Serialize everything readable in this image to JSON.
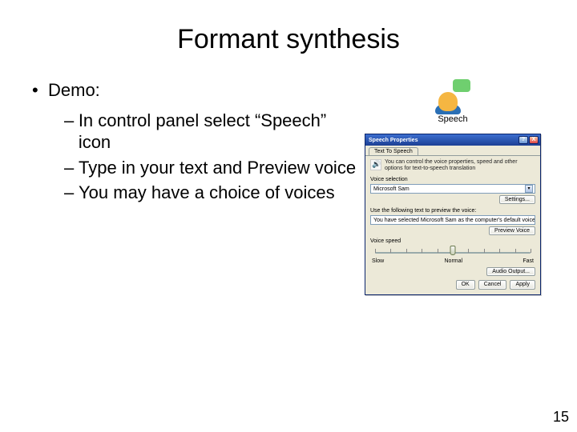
{
  "title": "Formant synthesis",
  "bullet_main": "Demo:",
  "subs": [
    "In control panel select “Speech” icon",
    "Type in your text and Preview voice",
    "You may have a choice of voices"
  ],
  "speech_icon_label": "Speech",
  "dialog": {
    "title": "Speech Properties",
    "help": "?",
    "close": "X",
    "tab": "Text To Speech",
    "hint": "You can control the voice properties, speed and other options for text-to-speech translation",
    "voice_group": "Voice selection",
    "voice_value": "Microsoft Sam",
    "settings_btn": "Settings...",
    "preview_label": "Use the following text to preview the voice:",
    "preview_text": "You have selected Microsoft Sam as the computer's default voice.",
    "preview_btn": "Preview Voice",
    "speed_group": "Voice speed",
    "slow": "Slow",
    "normal": "Normal",
    "fast": "Fast",
    "audio_btn": "Audio Output...",
    "ok_btn": "OK",
    "cancel_btn": "Cancel",
    "apply_btn": "Apply"
  },
  "page_number": "15"
}
